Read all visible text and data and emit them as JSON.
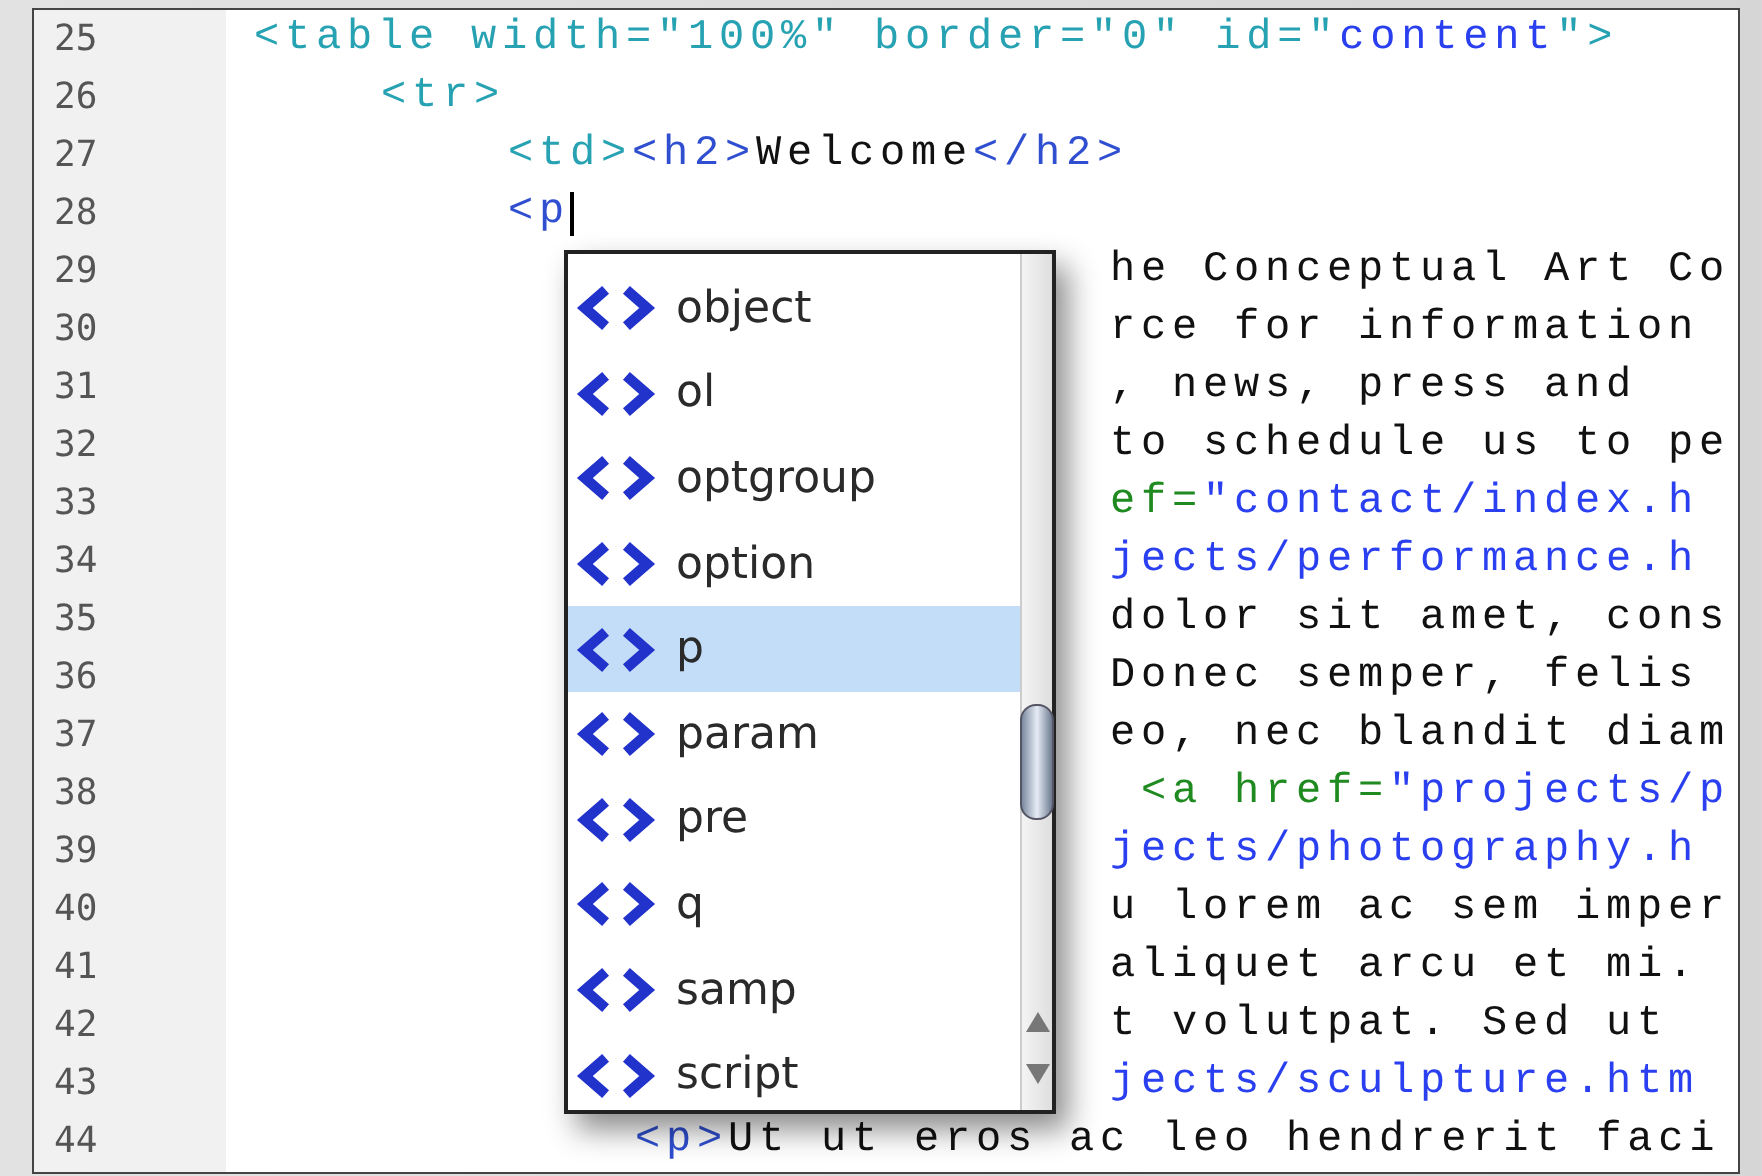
{
  "editor": {
    "lines": [
      {
        "number": "25",
        "covered": false,
        "caret": false,
        "segments": [
          {
            "kind": "tag",
            "text": "<table width=\"100%\" border=\"0\" id=\""
          },
          {
            "kind": "value",
            "text": "content"
          },
          {
            "kind": "tag",
            "text": "\">"
          }
        ],
        "children": [
          {
            "number": "26",
            "covered": false,
            "caret": false,
            "segments": [
              {
                "kind": "tag",
                "text": "<tr>"
              }
            ],
            "children": [
              {
                "number": "27",
                "covered": false,
                "caret": false,
                "segments": [
                  {
                    "kind": "tag",
                    "text": "<td>"
                  },
                  {
                    "kind": "tag2",
                    "text": "<h2>"
                  },
                  {
                    "kind": "text",
                    "text": "Welcome"
                  },
                  {
                    "kind": "tag2",
                    "text": "</h2>"
                  }
                ]
              },
              {
                "number": "28",
                "covered": false,
                "caret": true,
                "segments": [
                  {
                    "kind": "tag2",
                    "text": "<p"
                  }
                ],
                "children": [
                  {
                    "number": "29",
                    "covered": true,
                    "caret": false,
                    "segments": [
                      {
                        "kind": "text",
                        "text": "he Conceptual Art Co"
                      }
                    ]
                  },
                  {
                    "number": "30",
                    "covered": true,
                    "caret": false,
                    "segments": [
                      {
                        "kind": "text",
                        "text": "rce for information"
                      }
                    ]
                  },
                  {
                    "number": "31",
                    "covered": true,
                    "caret": false,
                    "segments": [
                      {
                        "kind": "text",
                        "text": ", news, press and"
                      }
                    ]
                  },
                  {
                    "number": "32",
                    "covered": true,
                    "caret": false,
                    "segments": [
                      {
                        "kind": "text",
                        "text": "to schedule us to pe"
                      }
                    ]
                  },
                  {
                    "number": "33",
                    "covered": true,
                    "caret": false,
                    "segments": [
                      {
                        "kind": "attr",
                        "text": "ef="
                      },
                      {
                        "kind": "value",
                        "text": "\"contact/index.h"
                      }
                    ]
                  },
                  {
                    "number": "34",
                    "covered": true,
                    "caret": false,
                    "segments": [
                      {
                        "kind": "value",
                        "text": "jects/performance.h"
                      }
                    ]
                  },
                  {
                    "number": "35",
                    "covered": true,
                    "caret": false,
                    "segments": [
                      {
                        "kind": "text",
                        "text": "dolor sit amet, cons"
                      }
                    ]
                  },
                  {
                    "number": "36",
                    "covered": true,
                    "caret": false,
                    "segments": [
                      {
                        "kind": "text",
                        "text": "Donec semper, felis"
                      }
                    ]
                  },
                  {
                    "number": "37",
                    "covered": true,
                    "caret": false,
                    "segments": [
                      {
                        "kind": "text",
                        "text": "eo, nec blandit diam"
                      }
                    ]
                  },
                  {
                    "number": "38",
                    "covered": true,
                    "caret": false,
                    "segments": [
                      {
                        "kind": "attr",
                        "text": " <a href="
                      },
                      {
                        "kind": "value",
                        "text": "\"projects/p"
                      }
                    ]
                  },
                  {
                    "number": "39",
                    "covered": true,
                    "caret": false,
                    "segments": [
                      {
                        "kind": "value",
                        "text": "jects/photography.h"
                      }
                    ]
                  },
                  {
                    "number": "40",
                    "covered": true,
                    "caret": false,
                    "segments": [
                      {
                        "kind": "text",
                        "text": "u lorem ac sem imper"
                      }
                    ]
                  },
                  {
                    "number": "41",
                    "covered": true,
                    "caret": false,
                    "segments": [
                      {
                        "kind": "text",
                        "text": "aliquet arcu et mi."
                      }
                    ]
                  },
                  {
                    "number": "42",
                    "covered": true,
                    "caret": false,
                    "segments": [
                      {
                        "kind": "text",
                        "text": "t volutpat. Sed ut"
                      }
                    ]
                  },
                  {
                    "number": "43",
                    "covered": true,
                    "caret": false,
                    "segments": [
                      {
                        "kind": "value",
                        "text": "jects/sculpture.htm"
                      }
                    ]
                  },
                  {
                    "number": "44",
                    "covered": false,
                    "caret": false,
                    "segments": [
                      {
                        "kind": "tag2",
                        "text": "<p>"
                      },
                      {
                        "kind": "text",
                        "text": "Ut ut eros ac leo hendrerit faci"
                      }
                    ]
                  }
                ]
              }
            ]
          }
        ]
      }
    ]
  },
  "completion": {
    "items": [
      {
        "label": "object",
        "selected": false
      },
      {
        "label": "ol",
        "selected": false
      },
      {
        "label": "optgroup",
        "selected": false
      },
      {
        "label": "option",
        "selected": false
      },
      {
        "label": "p",
        "selected": true
      },
      {
        "label": "param",
        "selected": false
      },
      {
        "label": "pre",
        "selected": false
      },
      {
        "label": "q",
        "selected": false
      },
      {
        "label": "samp",
        "selected": false
      },
      {
        "label": "script",
        "selected": false
      }
    ]
  }
}
